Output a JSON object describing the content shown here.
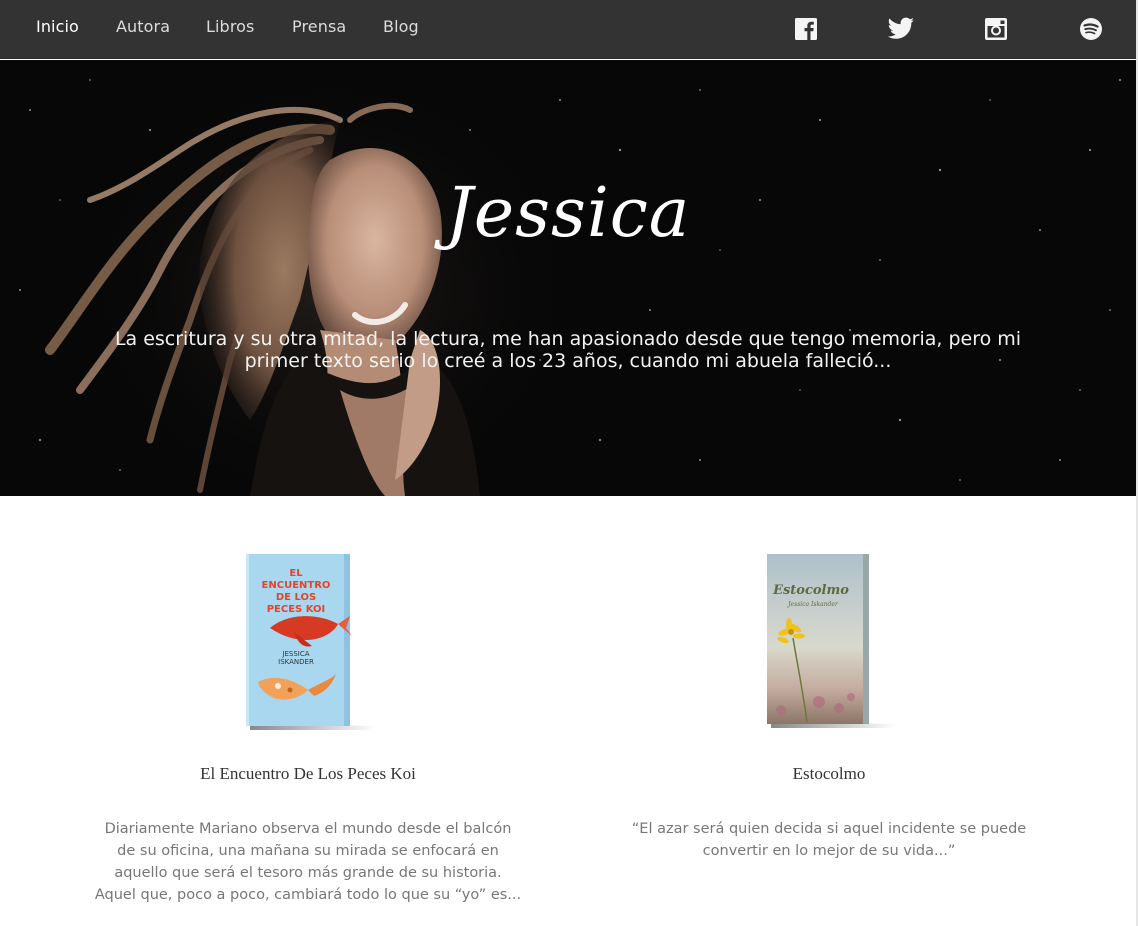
{
  "nav": {
    "links": [
      {
        "label": "Inicio",
        "active": true
      },
      {
        "label": "Autora",
        "active": false
      },
      {
        "label": "Libros",
        "active": false
      },
      {
        "label": "Prensa",
        "active": false
      },
      {
        "label": "Blog",
        "active": false
      }
    ],
    "social": [
      "facebook-icon",
      "twitter-icon",
      "instagram-icon",
      "spotify-icon"
    ]
  },
  "hero": {
    "title": "Jessica",
    "text": "La escritura y su otra mitad, la lectura, me han apasionado desde que tengo memoria, pero mi primer texto serio lo creé a los 23 años, cuando mi abuela falleció..."
  },
  "books": [
    {
      "title": "El Encuentro De Los Peces Koi",
      "cover_lines": [
        "EL",
        "ENCUENTRO",
        "DE LOS",
        "PECES KOI"
      ],
      "cover_author": [
        "JESSICA",
        "ISKANDER"
      ],
      "description": "Diariamente Mariano observa el mundo desde el balcón de su oficina, una mañana su mirada se enfocará en aquello que será el tesoro más grande de su historia. Aquel que, poco a poco, cambiará todo lo que su “yo” es..."
    },
    {
      "title": "Estocolmo",
      "cover_title": "Estocolmo",
      "cover_author": "Jessica Iskander",
      "description": "“El azar será quien decida si aquel incidente se puede convertir en lo mejor de su vida...”"
    }
  ],
  "colors": {
    "nav_bg": "#333333",
    "hero_bg": "#070707",
    "koi_cover": "#a9d7ef",
    "koi_text": "#e2452a"
  }
}
